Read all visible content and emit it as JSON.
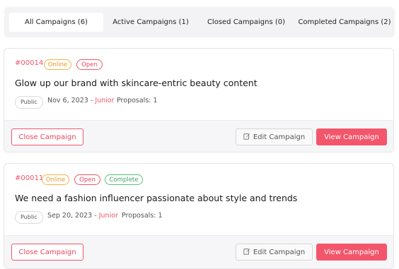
{
  "tabs": [
    {
      "label": "All Campaigns (6)"
    },
    {
      "label": "Active Campaigns (1)"
    },
    {
      "label": "Closed Campaigns (0)"
    },
    {
      "label": "Completed Campaigns (2)"
    }
  ],
  "campaigns": [
    {
      "id": "#00014",
      "badges": [
        "Online",
        "Open"
      ],
      "title": "Glow up our brand with skincare-entric beauty content",
      "visibility": "Public",
      "date": "Nov 6, 2023",
      "separator": "-",
      "level": "Junior",
      "proposals": "Proposals: 1",
      "close_label": "Close Campaign",
      "edit_label": "Edit Campaign",
      "view_label": "View Campaign"
    },
    {
      "id": "#00011",
      "badges": [
        "Online",
        "Open",
        "Complete"
      ],
      "title": "We need a fashion influencer passionate about style and trends",
      "visibility": "Public",
      "date": "Sep 20, 2023",
      "separator": "-",
      "level": "Junior",
      "proposals": "Proposals: 1",
      "close_label": "Close Campaign",
      "edit_label": "Edit Campaign",
      "view_label": "View Campaign"
    }
  ],
  "colors": {
    "accent": "#f3566b",
    "online": "#f5b245",
    "complete": "#58c07a"
  }
}
